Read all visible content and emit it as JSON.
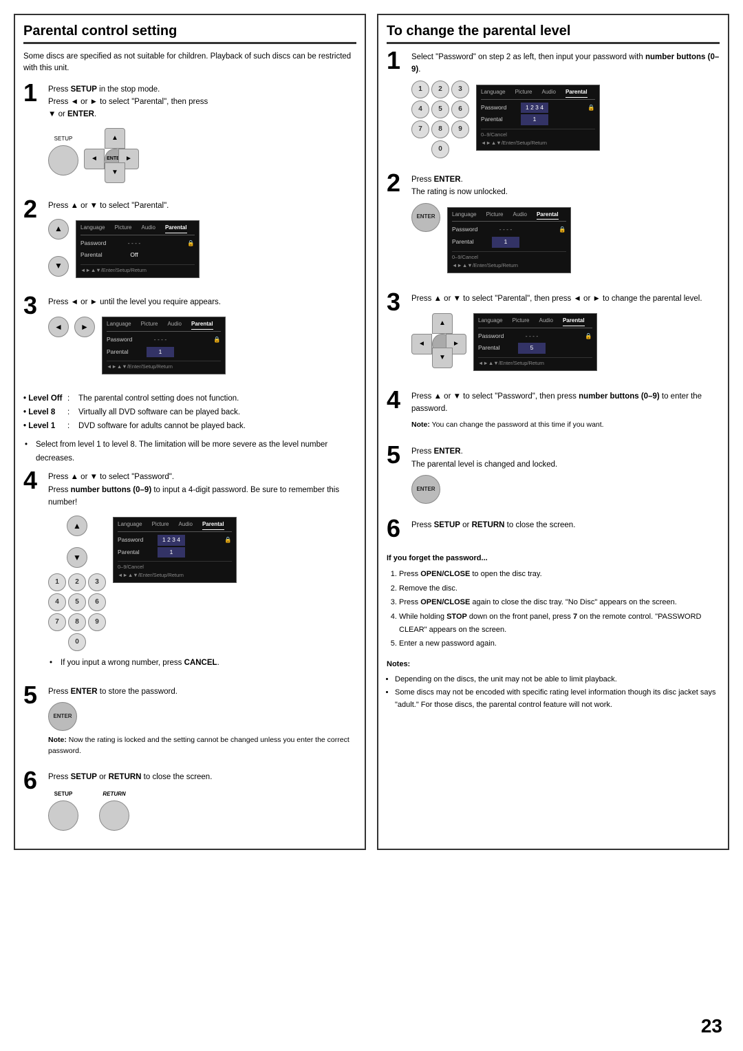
{
  "left": {
    "title": "Parental control setting",
    "intro": "Some discs are specified as not suitable for children. Playback of such discs can be restricted with this unit.",
    "steps": [
      {
        "num": "1",
        "lines": [
          "Press SETUP in the stop mode.",
          "Press ◄ or ► to select \"Parental\", then press",
          "▼ or ENTER."
        ]
      },
      {
        "num": "2",
        "lines": [
          "Press ▲ or ▼ to select \"Parental\"."
        ]
      },
      {
        "num": "3",
        "lines": [
          "Press ◄ or ► until the level you require appears."
        ]
      },
      {
        "num": "4",
        "lines": [
          "Press ▲ or ▼ to select \"Password\".",
          "Press number buttons (0–9) to input a 4-digit password. Be sure to remember this number!"
        ]
      },
      {
        "num": "5",
        "lines": [
          "Press ENTER to store the password."
        ]
      },
      {
        "num": "6",
        "lines": [
          "Press SETUP or RETURN to close the screen."
        ]
      }
    ],
    "level_descriptions": [
      {
        "key": "Level Off",
        "sep": ":",
        "desc": "The parental control setting does not function."
      },
      {
        "key": "Level 8",
        "sep": ":",
        "desc": "Virtually all DVD software can be played back."
      },
      {
        "key": "Level 1",
        "sep": ":",
        "desc": "DVD software for adults cannot be played back."
      }
    ],
    "select_note": "Select from level 1 to level 8. The limitation will be more severe as the level number decreases.",
    "wrong_number_note": "If you input a wrong number, press CANCEL.",
    "note_text": "Note: Now the rating is locked and the setting cannot be changed unless you enter the correct password.",
    "menu_labels": {
      "language": "Language",
      "picture": "Picture",
      "audio": "Audio",
      "parental": "Parental",
      "password": "Password",
      "parental_row": "Parental",
      "password_val_dash": "----",
      "parental_val_off": "Off",
      "parental_val_1": "1",
      "password_val_1234": "1 2 3 4",
      "hint1": "0–9/Cancel",
      "hint2": "◄►▲▼/Enter/Setup/Return"
    }
  },
  "right": {
    "title": "To change the parental level",
    "steps": [
      {
        "num": "1",
        "lines": [
          "Select \"Password\" on step 2 as left, then input your password with number buttons (0–9)."
        ]
      },
      {
        "num": "2",
        "lines": [
          "Press ENTER.",
          "The rating is now unlocked."
        ]
      },
      {
        "num": "3",
        "lines": [
          "Press ▲ or ▼ to select \"Parental\", then press ◄ or ► to change the parental level."
        ]
      },
      {
        "num": "4",
        "lines": [
          "Press ▲ or ▼ to select \"Password\", then press number buttons (0–9) to enter the password."
        ]
      },
      {
        "num": "5",
        "lines": [
          "Press ENTER.",
          "The parental level is changed and locked."
        ]
      },
      {
        "num": "6",
        "lines": [
          "Press SETUP or RETURN to close the screen."
        ]
      }
    ],
    "note_step4": "Note: You can change the password at this time if you want.",
    "forget_password_title": "If you forget the password...",
    "forget_steps": [
      "Press OPEN/CLOSE to open the disc tray.",
      "Remove the disc.",
      "Press OPEN/CLOSE again to close the disc tray. \"No Disc\" appears on the screen.",
      "While holding STOP down on the front panel, press 7 on the remote control. \"PASSWORD CLEAR\" appears on the screen.",
      "Enter a new password again."
    ],
    "notes_title": "Notes:",
    "notes": [
      "Depending on the discs, the unit may not be able to limit playback.",
      "Some discs may not be encoded with specific rating level information though its disc jacket says \"adult.\" For those discs, the parental control feature will not work."
    ]
  },
  "page_number": "23"
}
